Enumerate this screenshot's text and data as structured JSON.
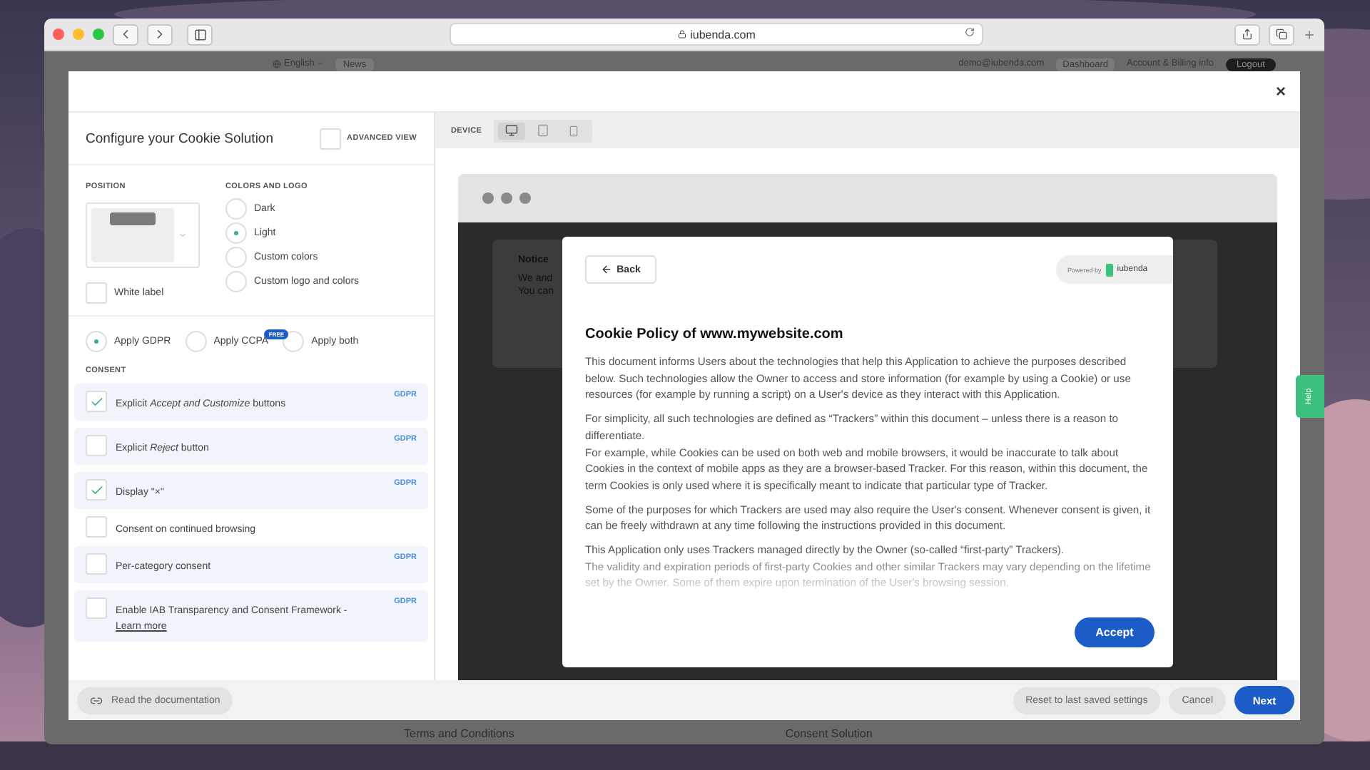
{
  "browser": {
    "address": "iubenda.com"
  },
  "site_header": {
    "language": "English",
    "news": "News",
    "email": "demo@iubenda.com",
    "dashboard": "Dashboard",
    "account": "Account & Billing info",
    "logout": "Logout"
  },
  "modal": {
    "close": "×",
    "left": {
      "title": "Configure your Cookie Solution",
      "advanced_view": {
        "label": "ADVANCED VIEW",
        "checked": false
      },
      "position_label": "POSITION",
      "colors_label": "COLORS AND LOGO",
      "colors": [
        {
          "label": "Dark",
          "selected": false
        },
        {
          "label": "Light",
          "selected": true
        },
        {
          "label": "Custom colors",
          "selected": false
        },
        {
          "label": "Custom logo and colors",
          "selected": false
        }
      ],
      "white_label": {
        "label": "White label",
        "checked": false
      },
      "apply": [
        {
          "label": "Apply GDPR",
          "selected": true
        },
        {
          "label": "Apply CCPA",
          "selected": false,
          "badge": "FREE"
        },
        {
          "label": "Apply both",
          "selected": false
        }
      ],
      "consent_label": "CONSENT",
      "consent": [
        {
          "label": "Explicit *Accept and Customize* buttons",
          "checked": true,
          "tag": "GDPR"
        },
        {
          "label": "Explicit *Reject* button",
          "checked": false,
          "tag": "GDPR"
        },
        {
          "label": "Display \"×\"",
          "checked": true,
          "tag": "GDPR"
        },
        {
          "label": "Consent on continued browsing",
          "checked": false
        },
        {
          "label": "Per-category consent",
          "checked": false,
          "tag": "GDPR"
        },
        {
          "label": "Enable IAB Transparency and Consent Framework -",
          "checked": false,
          "tag": "GDPR",
          "link": "Learn more"
        }
      ]
    },
    "right": {
      "device_label": "DEVICE",
      "devices": [
        {
          "kind": "desktop",
          "selected": true
        },
        {
          "kind": "tablet",
          "selected": false
        },
        {
          "kind": "phone",
          "selected": false
        }
      ],
      "notice": {
        "title": "Notice",
        "lines": [
          "We and",
          "You can"
        ]
      },
      "policy": {
        "back": "Back",
        "powered_by": "Powered by",
        "brand": "iubenda",
        "title": "Cookie Policy of www.mywebsite.com",
        "paragraphs": [
          [
            "This document informs Users about the technologies that help this Application to achieve the purposes described below. Such technologies allow the Owner to access and store information (for example by using a Cookie) or use resources (for example by running a script) on a User's device as they interact with this Application."
          ],
          [
            "For simplicity, all such technologies are defined as “Trackers” within this document – unless there is a reason to differentiate.",
            "For example, while Cookies can be used on both web and mobile browsers, it would be inaccurate to talk about Cookies in the context of mobile apps as they are a browser-based Tracker. For this reason, within this document, the term Cookies is only used where it is specifically meant to indicate that particular type of Tracker."
          ],
          [
            "Some of the purposes for which Trackers are used may also require the User's consent. Whenever consent is given, it can be freely withdrawn at any time following the instructions provided in this document."
          ],
          [
            "This Application only uses Trackers managed directly by the Owner (so-called “first-party” Trackers).",
            "The validity and expiration periods of first-party Cookies and other similar Trackers may vary depending on the lifetime set by the Owner. Some of them expire upon termination of the User's browsing session."
          ]
        ],
        "accept": "Accept"
      }
    },
    "footer": {
      "docs": "Read the documentation",
      "reset": "Reset to last saved settings",
      "cancel": "Cancel",
      "next": "Next"
    }
  },
  "page_footer": [
    "Terms and Conditions",
    "Consent Solution"
  ],
  "help_tab": "Help"
}
